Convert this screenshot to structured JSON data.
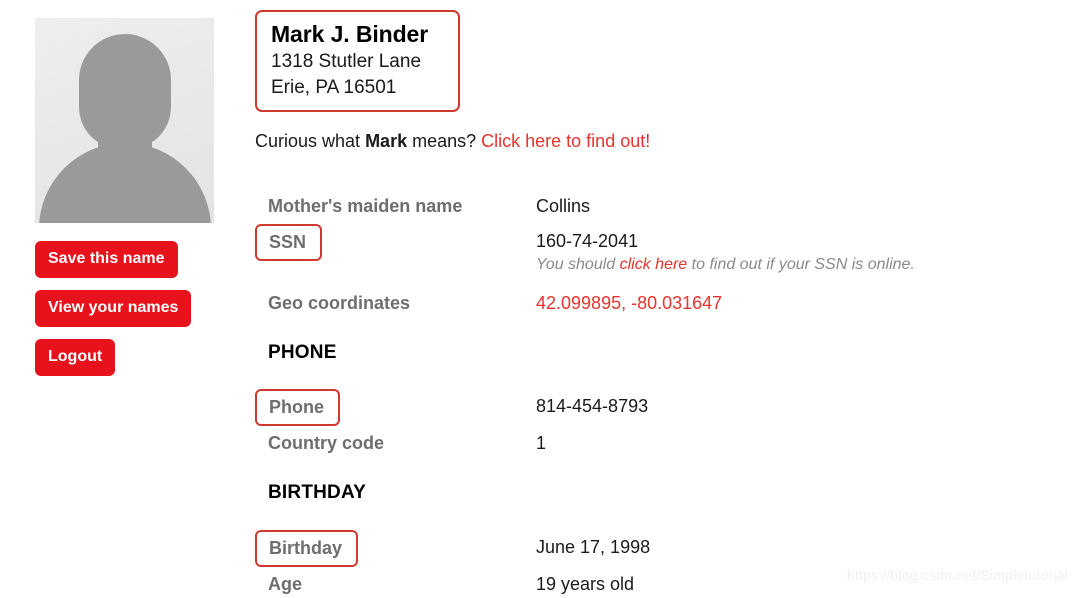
{
  "colors": {
    "accent_red": "#e8332e",
    "button_red": "#e8121c",
    "highlight_border": "#cf3a30",
    "label_gray": "#6e6e6e",
    "note_gray": "#8a8a8a",
    "watermark_gray": "#f0f0f0"
  },
  "sidebar": {
    "avatar_alt": "person-placeholder-silhouette",
    "buttons": [
      {
        "id": "save-this-name",
        "label": "Save this name"
      },
      {
        "id": "view-your-names",
        "label": "View your names"
      },
      {
        "id": "logout",
        "label": "Logout"
      }
    ]
  },
  "identity": {
    "name": "Mark J. Binder",
    "street": "1318 Stutler Lane",
    "city_state_zip": "Erie, PA 16501"
  },
  "meaning": {
    "prefix": "Curious what ",
    "name": "Mark",
    "suffix": " means? ",
    "link": "Click here to find out!"
  },
  "fields": {
    "mothers_maiden_name": {
      "label": "Mother's maiden name",
      "value": "Collins"
    },
    "ssn": {
      "label": "SSN",
      "value": "160-74-2041",
      "note_prefix": "You should ",
      "note_link": "click here",
      "note_suffix": " to find out if your SSN is online."
    },
    "geo_coordinates": {
      "label": "Geo coordinates",
      "value": "42.099895, -80.031647"
    },
    "phone": {
      "label": "Phone",
      "value": "814-454-8793"
    },
    "country_code": {
      "label": "Country code",
      "value": "1"
    },
    "birthday": {
      "label": "Birthday",
      "value": "June 17, 1998"
    },
    "age": {
      "label": "Age",
      "value": "19 years old"
    }
  },
  "sections": {
    "phone_heading": "PHONE",
    "birthday_heading": "BIRTHDAY"
  },
  "watermark": {
    "text": "https://blog.csdn.net/Simpletutorial"
  }
}
